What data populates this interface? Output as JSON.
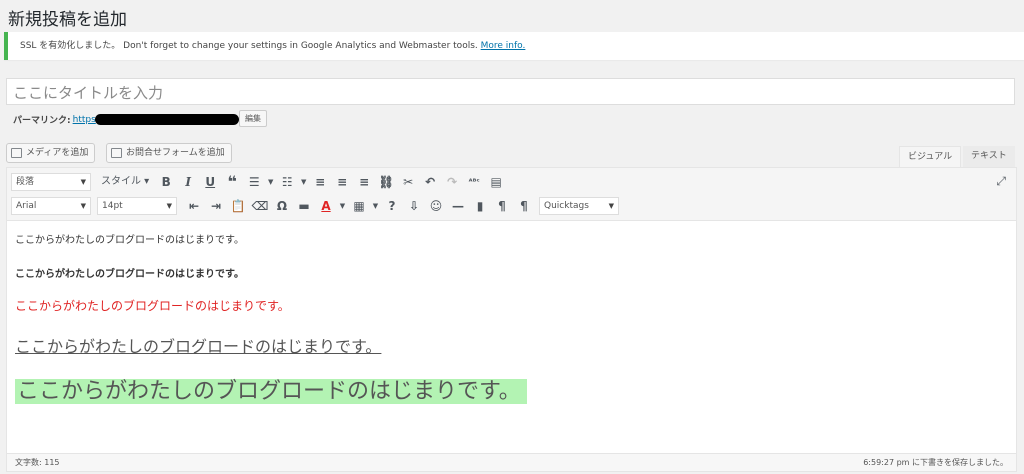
{
  "page": {
    "title": "新規投稿を追加"
  },
  "notice": {
    "text": "SSL を有効化しました。 Don't forget to change your settings in Google Analytics and Webmaster tools.",
    "link": "More info.",
    "accent": "#46b450"
  },
  "title_field": {
    "placeholder": "ここにタイトルを入力"
  },
  "permalink": {
    "label": "パーマリンク:",
    "url": "https",
    "edit_label": "編集"
  },
  "media_buttons": {
    "add_media": "メディアを追加",
    "add_form": "お問合せフォームを追加"
  },
  "tabs": {
    "visual": "ビジュアル",
    "text": "テキスト"
  },
  "toolbar": {
    "format_select": "段落",
    "styles": "スタイル",
    "font_family": "Arial",
    "font_size": "14pt",
    "quicktags": "Quicktags",
    "icons": [
      "bold-icon",
      "italic-icon",
      "underline-icon",
      "blockquote-icon",
      "bullet-list-icon",
      "numbered-list-icon",
      "align-left-icon",
      "align-center-icon",
      "align-right-icon",
      "link-icon",
      "unlink-icon",
      "undo-icon",
      "redo-icon",
      "spellcheck-icon",
      "toolbar-toggle-icon",
      "fullscreen-icon"
    ]
  },
  "content": {
    "lines": [
      "ここからがわたしのブログロードのはじまりです。",
      "ここからがわたしのブログロードのはじまりです。",
      "ここからがわたしのブログロードのはじまりです。",
      "ここからがわたしのブログロードのはじまりです。",
      "ここからがわたしのブログロードのはじまりです。"
    ],
    "colors": {
      "red": "#e02424",
      "highlight": "#b3f3b3"
    }
  },
  "statusbar": {
    "word_count": "文字数: 115",
    "saved": "6:59:27 pm に下書きを保存しました。"
  }
}
